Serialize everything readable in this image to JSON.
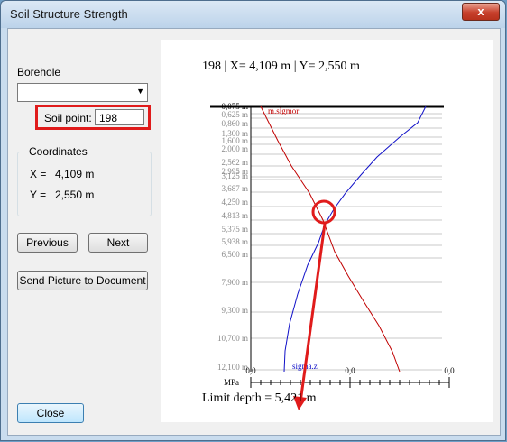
{
  "window": {
    "title": "Soil Structure Strength",
    "close_glyph": "x"
  },
  "left": {
    "borehole_label": "Borehole",
    "borehole_value": "",
    "soil_point_label": "Soil point:",
    "soil_point_value": "198",
    "coordinates_title": "Coordinates",
    "x_label": "X =",
    "x_value": "4,109 m",
    "y_label": "Y =",
    "y_value": "2,550 m",
    "previous_label": "Previous",
    "next_label": "Next",
    "send_label": "Send Picture to Document",
    "close_label": "Close"
  },
  "plot": {
    "title": "198 | X= 4,109 m | Y= 2,550 m",
    "limit_text": "Limit depth = 5,421 m",
    "unit": "MPa",
    "ticks_top": [
      "0,0",
      "0,0",
      "0,0"
    ],
    "depth_labels": [
      "0,075 m",
      "0,625 m",
      "0,860 m",
      "1,300 m",
      "1,600 m",
      "2,000 m",
      "2,562 m",
      "2,995 m",
      "3,125 m",
      "3,687 m",
      "4,250 m",
      "4,813 m",
      "5,375 m",
      "5,938 m",
      "6,500 m",
      "7,900 m",
      "9,300 m",
      "10,700 m",
      "12,100 m"
    ],
    "curve_labels": {
      "m_sigmor": "m.sigmor",
      "sigma_z": "sigma.z"
    },
    "colors": {
      "m_sigmor": "#c00000",
      "sigma_z": "#1010c8",
      "annotation": "#e01b1b"
    }
  }
}
